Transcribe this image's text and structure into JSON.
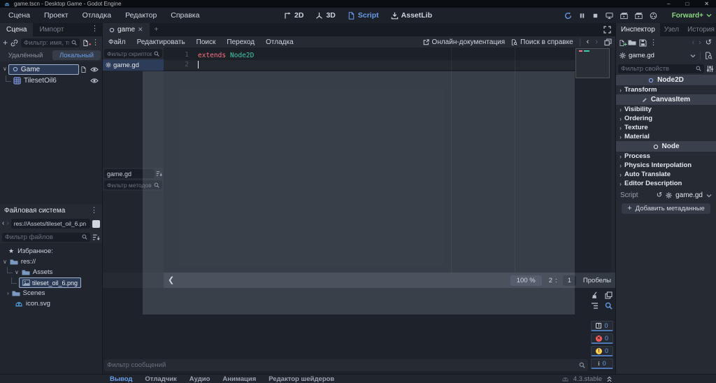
{
  "window": {
    "title": "game.tscn - Desktop Game - Godot Engine",
    "minimize": "–",
    "maximize": "□",
    "close": "✕"
  },
  "menubar": {
    "items": [
      "Сцена",
      "Проект",
      "Отладка",
      "Редактор",
      "Справка"
    ],
    "workspaces": [
      "2D",
      "3D",
      "Script",
      "AssetLib"
    ],
    "active_workspace": "Script",
    "renderer": "Forward+"
  },
  "scene_dock": {
    "tabs": [
      "Сцена",
      "Импорт"
    ],
    "filter_placeholder": "Фильтр: имя, ти",
    "view_tabs": [
      "Удалённый",
      "Локальный"
    ],
    "active_view_tab": "Локальный",
    "root_node": "Game",
    "child_node": "TilesetOil6"
  },
  "filesystem_dock": {
    "title": "Файловая система",
    "path": "res://Assets/tileset_oil_6.pn",
    "filter_placeholder": "Фильтр файлов",
    "favorites": "Избранное:",
    "items": [
      "res://",
      "Assets",
      "tileset_oil_6.png",
      "Scenes",
      "icon.svg"
    ],
    "selected_item": "tileset_oil_6.png"
  },
  "script_editor": {
    "tab": "game",
    "menus": [
      "Файл",
      "Редактировать",
      "Поиск",
      "Переход",
      "Отладка"
    ],
    "online_docs": "Онлайн-документация",
    "search_help": "Поиск в справке",
    "scripts_filter_placeholder": "Фильтр скриптов",
    "script_item": "game.gd",
    "current_script": "game.gd",
    "methods_filter_placeholder": "Фильтр методов",
    "code": {
      "line_numbers": [
        "1",
        "2"
      ],
      "keyword": "extends",
      "type": "Node2D"
    },
    "status": {
      "zoom": "100 %",
      "line": "2",
      "colon": ":",
      "column": "1",
      "indent": "Пробелы"
    }
  },
  "output_panel": {
    "filter_placeholder": "Фильтр сообщений",
    "counts": [
      "0",
      "0",
      "0",
      "0"
    ]
  },
  "bottom_bar": {
    "tabs": [
      "Вывод",
      "Отладчик",
      "Аудио",
      "Анимация",
      "Редактор шейдеров"
    ],
    "active_tab": "Вывод",
    "version": "4.3.stable"
  },
  "inspector": {
    "tabs": [
      "Инспектор",
      "Узел",
      "История"
    ],
    "active_tab": "Инспектор",
    "resource": "game.gd",
    "filter_placeholder": "Фильтр свойств",
    "sections": [
      {
        "kind": "category",
        "label": "Node2D"
      },
      {
        "kind": "group",
        "label": "Transform"
      },
      {
        "kind": "category",
        "label": "CanvasItem"
      },
      {
        "kind": "group",
        "label": "Visibility"
      },
      {
        "kind": "group",
        "label": "Ordering"
      },
      {
        "kind": "group",
        "label": "Texture"
      },
      {
        "kind": "group",
        "label": "Material"
      },
      {
        "kind": "category",
        "label": "Node"
      },
      {
        "kind": "group",
        "label": "Process"
      },
      {
        "kind": "group",
        "label": "Physics Interpolation"
      },
      {
        "kind": "group",
        "label": "Auto Translate"
      },
      {
        "kind": "group",
        "label": "Editor Description"
      }
    ],
    "script_property": {
      "label": "Script",
      "value": "game.gd"
    },
    "add_metadata": "Добавить метаданные"
  },
  "colors": {
    "accent": "#699ce8",
    "keyword": "#ff7085",
    "base_type": "#41c8a8",
    "renderer_green": "#8bd67f",
    "error": "#ff5d5d",
    "warning": "#ffce4f"
  }
}
